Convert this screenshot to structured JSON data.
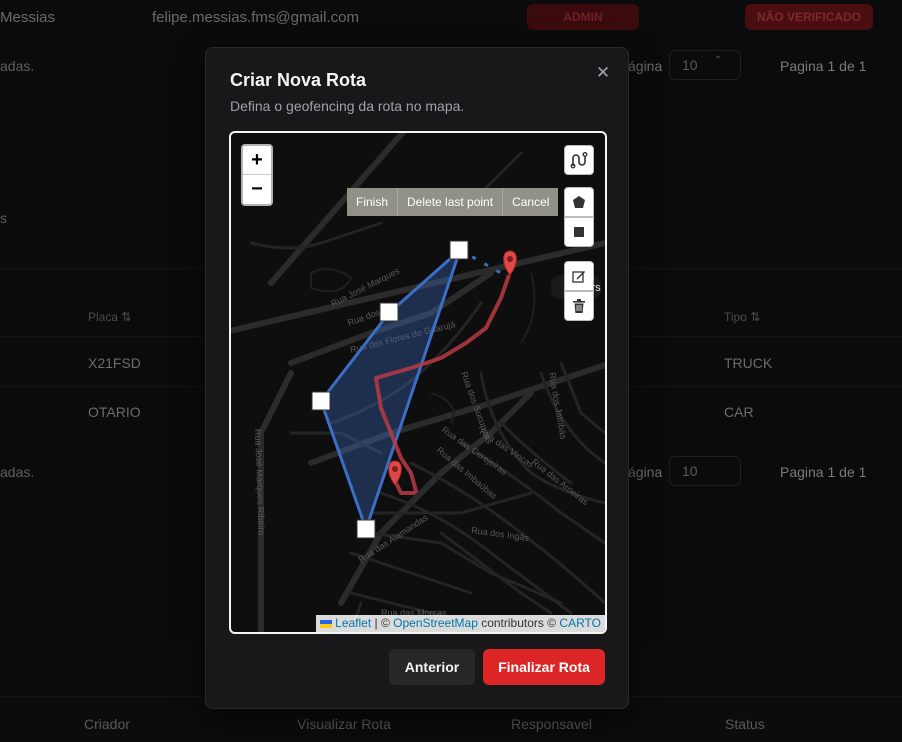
{
  "background": {
    "user_name": "Messias",
    "user_email": "felipe.messias.fms@gmail.com",
    "admin_badge": "ADMIN",
    "status_badge": "NÃO VERIFICADO",
    "top_pager": {
      "left_text": "adas.",
      "per_page_label": "ágina",
      "per_page_value": "10",
      "page_info": "Pagina 1 de 1"
    },
    "section_marker": "s",
    "table_headers": [
      "Placa",
      "Tipo"
    ],
    "rows": [
      {
        "placa": "X21FSD",
        "tipo": "TRUCK"
      },
      {
        "placa": "OTARIO",
        "tipo": "CAR"
      }
    ],
    "bottom_pager": {
      "left_text": "adas.",
      "per_page_label": "ágina",
      "per_page_value": "10",
      "page_info": "Pagina 1 de 1"
    },
    "bottom_headers": [
      "Criador",
      "Visualizar Rota",
      "Responsavel",
      "Status"
    ]
  },
  "modal": {
    "title": "Criar Nova Rota",
    "description": "Defina o geofencing da rota no mapa.",
    "close_icon": "close-icon",
    "map": {
      "zoom_in": "+",
      "zoom_out": "−",
      "draw_actions": [
        "Finish",
        "Delete last point",
        "Cancel"
      ],
      "tools": [
        "route-icon",
        "polygon-icon",
        "rectangle-icon",
        "edit-icon",
        "trash-icon"
      ],
      "street_labels": [
        "Rua José Marques",
        "Rua José Marques Ribeiro",
        "Rua dos Flores do Guarujá",
        "Rua dos Sucupiras",
        "Rua das Imbaúbas",
        "Rua das Cerejeiras",
        "Rua das Vincas",
        "Rua das Aroeiras",
        "Rua dos Ingás",
        "Rua das Alamandas",
        "Rua dos Jatobás",
        "Rua das Morças",
        "Rua dos Sc"
      ],
      "route_popup_fragment": "irs",
      "attribution": {
        "leaflet": "Leaflet",
        "sep": " | © ",
        "osm": "OpenStreetMap",
        "contrib": " contributors © ",
        "carto": "CARTO"
      },
      "colors": {
        "polygon": "#3b6ec4",
        "route": "#b83a44",
        "marker": "#e04848"
      }
    },
    "buttons": {
      "previous": "Anterior",
      "finish": "Finalizar Rota"
    }
  }
}
